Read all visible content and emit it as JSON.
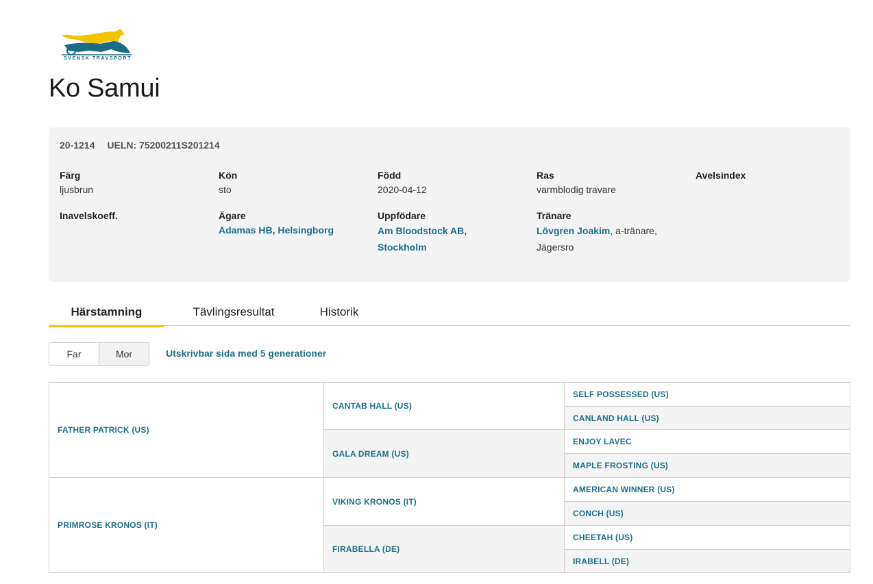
{
  "brand": {
    "logo_text": "SVENSK TRAVSPORT"
  },
  "horse": {
    "name": "Ko Samui",
    "reg_no": "20-1214",
    "ueln": "UELN: 75200211S201214"
  },
  "info": {
    "color_label": "Färg",
    "color_value": "ljusbrun",
    "sex_label": "Kön",
    "sex_value": "sto",
    "born_label": "Född",
    "born_value": "2020-04-12",
    "breed_label": "Ras",
    "breed_value": "varmblodig travare",
    "index_label": "Avelsindex",
    "inbreeding_label": "Inavelskoeff.",
    "owner_label": "Ägare",
    "owner_value": "Adamas HB, Helsingborg",
    "breeder_label": "Uppfödare",
    "breeder_line1": "Am Bloodstock AB,",
    "breeder_line2": "Stockholm",
    "trainer_label": "Tränare",
    "trainer_name": "Lövgren Joakim",
    "trainer_role": ", a-tränare,",
    "trainer_place": "Jägersro"
  },
  "tabs": [
    "Härstamning",
    "Tävlingsresultat",
    "Historik"
  ],
  "toggle": {
    "far": "Far",
    "mor": "Mor"
  },
  "print_link": "Utskrivbar sida med 5 generationer",
  "pedigree": {
    "gen1": [
      "FATHER PATRICK (US)",
      "PRIMROSE KRONOS (IT)"
    ],
    "gen2": [
      "CANTAB HALL (US)",
      "GALA DREAM (US)",
      "VIKING KRONOS (IT)",
      "FIRABELLA (DE)"
    ],
    "gen3": [
      "SELF POSSESSED (US)",
      "CANLAND HALL (US)",
      "ENJOY LAVEC",
      "MAPLE FROSTING (US)",
      "AMERICAN WINNER (US)",
      "CONCH (US)",
      "CHEETAH (US)",
      "IRABELL (DE)"
    ]
  },
  "colors": {
    "link": "#1d6f8a",
    "accent": "#f2c500",
    "panel": "#f4f4f4"
  }
}
